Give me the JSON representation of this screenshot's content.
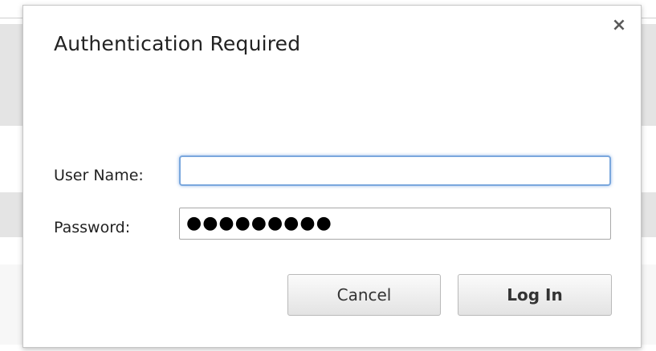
{
  "dialog": {
    "title": "Authentication Required",
    "close_icon": "close-icon"
  },
  "form": {
    "username_label": "User Name:",
    "username_value": "",
    "password_label": "Password:",
    "password_mask": "●●●●●●●●●"
  },
  "buttons": {
    "cancel_label": "Cancel",
    "login_label": "Log In"
  },
  "colors": {
    "focus_border": "#7aa7dd",
    "dialog_border": "#c6c6c6"
  }
}
